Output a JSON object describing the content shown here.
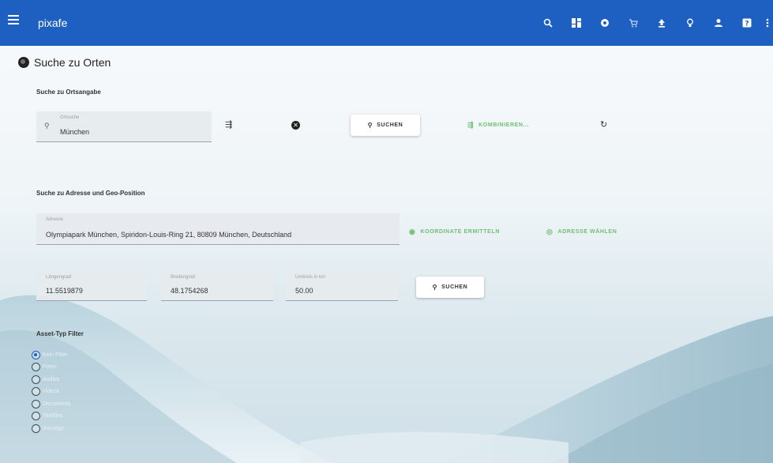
{
  "appbar": {
    "brand": "pixafe",
    "icons": [
      "search-icon",
      "dashboard-icon",
      "settings-icon",
      "cart-icon",
      "upload-icon",
      "lightbulb-icon",
      "account-icon",
      "help-icon",
      "more-icon"
    ]
  },
  "page": {
    "title": "Suche zu Orten"
  },
  "place_search": {
    "section_label": "Suche zu Ortsangabe",
    "field_label": "Ortsuche",
    "field_value": "München",
    "search_label": "SUCHEN",
    "combine_label": "KOMBINIEREN..."
  },
  "address_search": {
    "section_label": "Suche zu Adresse und Geo-Position",
    "address_label": "Adresse",
    "address_value": "Olympiapark München, Spiridon-Louis-Ring 21, 80809 München, Deutschland",
    "coords_button": "KOORDINATE ERMITTELN",
    "address_button": "ADRESSE WÄHLEN",
    "lon_label": "Längengrad",
    "lon_value": "11.5519879",
    "lat_label": "Breitengrad",
    "lat_value": "48.1754268",
    "radius_label": "Umkreis in km",
    "radius_value": "50.00",
    "search_label": "SUCHEN"
  },
  "asset_filter": {
    "title": "Asset-Typ Filter",
    "options": [
      "Kein Filter",
      "Fotos",
      "Audios",
      "Videos",
      "Documents",
      "Textfiles",
      "Sonstige"
    ],
    "selected_index": 0
  },
  "colors": {
    "appbar": "#1e5fc2",
    "accent_green": "#6fbf73"
  }
}
